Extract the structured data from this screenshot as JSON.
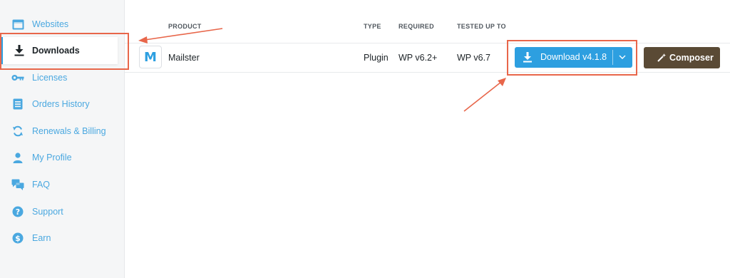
{
  "sidebar": {
    "items": [
      {
        "label": "Websites",
        "icon": "browser-window-icon"
      },
      {
        "label": "Downloads",
        "icon": "download-icon",
        "active": true
      },
      {
        "label": "Licenses",
        "icon": "key-icon"
      },
      {
        "label": "Orders History",
        "icon": "document-list-icon"
      },
      {
        "label": "Renewals & Billing",
        "icon": "refresh-icon"
      },
      {
        "label": "My Profile",
        "icon": "user-icon"
      },
      {
        "label": "FAQ",
        "icon": "chat-bubbles-icon"
      },
      {
        "label": "Support",
        "icon": "help-circle-icon"
      },
      {
        "label": "Earn",
        "icon": "dollar-circle-icon"
      }
    ]
  },
  "table": {
    "headers": {
      "product": "PRODUCT",
      "type": "TYPE",
      "required": "REQUIRED",
      "tested": "TESTED UP TO"
    },
    "row": {
      "product": "Mailster",
      "logo_letter": "M",
      "type": "Plugin",
      "required": "WP v6.2+",
      "tested": "WP v6.7"
    }
  },
  "actions": {
    "download_label": "Download v4.1.8",
    "composer_label": "Composer"
  },
  "colors": {
    "accent": "#2d9fe0",
    "composer": "#5a4a35",
    "annotation": "#e8664a",
    "sidebar_bg": "#f5f6f7"
  }
}
